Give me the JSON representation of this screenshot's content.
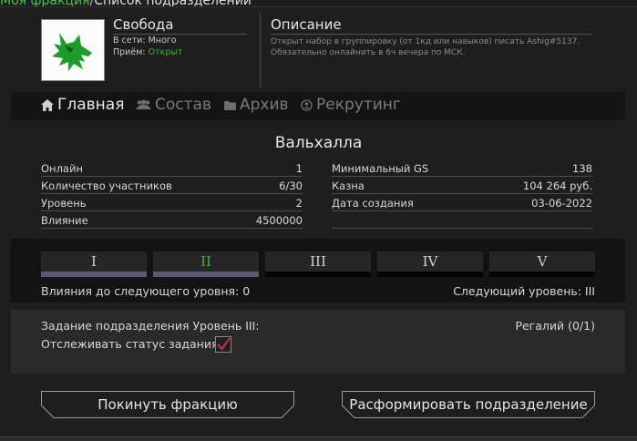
{
  "breadcrumb": {
    "link": "Моя фракция",
    "separator": "/",
    "current": "Список подразделений"
  },
  "faction": {
    "name": "Свобода",
    "online_label": "В сети:",
    "online_value": "Много",
    "recruit_label": "Приём:",
    "recruit_value": "Открыт"
  },
  "description": {
    "title": "Описание",
    "text": "Открыт набор в группировку (от 1кд или навыков) писать Ashig#5137. Обязательно онлайнить в 6ч вечера по МСК."
  },
  "tabs": [
    {
      "label": "Главная",
      "icon": "home-icon"
    },
    {
      "label": "Состав",
      "icon": "users-icon"
    },
    {
      "label": "Архив",
      "icon": "folder-icon"
    },
    {
      "label": "Рекрутинг",
      "icon": "recruit-icon"
    }
  ],
  "division": {
    "title": "Вальхалла"
  },
  "stats_left": [
    {
      "label": "Онлайн",
      "value": "1"
    },
    {
      "label": "Количество участников",
      "value": "6/30"
    },
    {
      "label": "Уровень",
      "value": "2"
    },
    {
      "label": "Влияние",
      "value": "4500000"
    }
  ],
  "stats_right": [
    {
      "label": "Минимальный GS",
      "value": "138"
    },
    {
      "label": "Казна",
      "value": "104 264 руб."
    },
    {
      "label": "Дата создания",
      "value": "03-06-2022"
    },
    {
      "label": "",
      "value": ""
    }
  ],
  "levels": {
    "items": [
      "I",
      "II",
      "III",
      "IV",
      "V"
    ],
    "current_index": 1,
    "influence_to_next": "Влияния до следующего уровня: 0",
    "next_level": "Следующий уровень: III"
  },
  "task": {
    "title": "Задание подразделения Уровень III:",
    "track_label": "Отслеживать статус задания:",
    "tracked": true,
    "regalia": "Регалий (0/1)"
  },
  "buttons": {
    "leave": "Покинуть фракцию",
    "disband": "Расформировать подразделение"
  },
  "colors": {
    "accent_green": "#3ab43a",
    "checkmark": "#c0303a",
    "level_bar": "#575a74"
  }
}
